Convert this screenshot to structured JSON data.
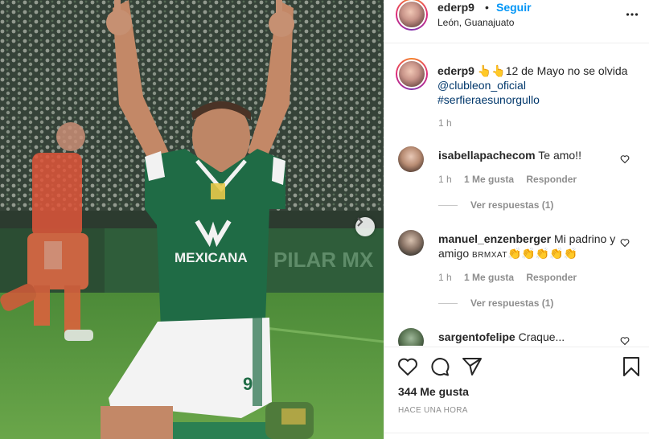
{
  "post": {
    "username": "ederp9",
    "dot": "•",
    "follow_label": "Seguir",
    "location": "León, Guanajuato",
    "caption": {
      "emoji": "👆👆",
      "text": "12 de Mayo no se olvida",
      "mention": "@clubleon_oficial",
      "hashtag": "#serfieraesunorgullo",
      "time": "1 h"
    },
    "likes": "344 Me gusta",
    "posted": "HACE UNA HORA",
    "photo": {
      "shirt_text": "MEXICANA",
      "number": "9"
    }
  },
  "comments": [
    {
      "username": "isabellapachecom",
      "text": "Te amo!!",
      "time": "1 h",
      "likes": "1 Me gusta",
      "reply_label": "Responder",
      "view_replies": "Ver respuestas (1)"
    },
    {
      "username": "manuel_enzenberger",
      "text": "Mi padrino y amigo",
      "small_caps": "BRMXAT",
      "emoji": "👏👏👏👏👏",
      "time": "1 h",
      "likes": "1 Me gusta",
      "reply_label": "Responder",
      "view_replies": "Ver respuestas (1)"
    },
    {
      "username": "sargentofelipe",
      "text": "Craque..."
    }
  ],
  "icons": {
    "more": "more-options-icon",
    "like": "heart-icon",
    "comment": "comment-icon",
    "share": "share-icon",
    "save": "bookmark-icon",
    "next": "chevron-right-icon"
  },
  "colors": {
    "accent": "#0095f6",
    "link": "#00376b",
    "muted": "#8e8e8e",
    "jersey_green": "#1f6b45"
  }
}
